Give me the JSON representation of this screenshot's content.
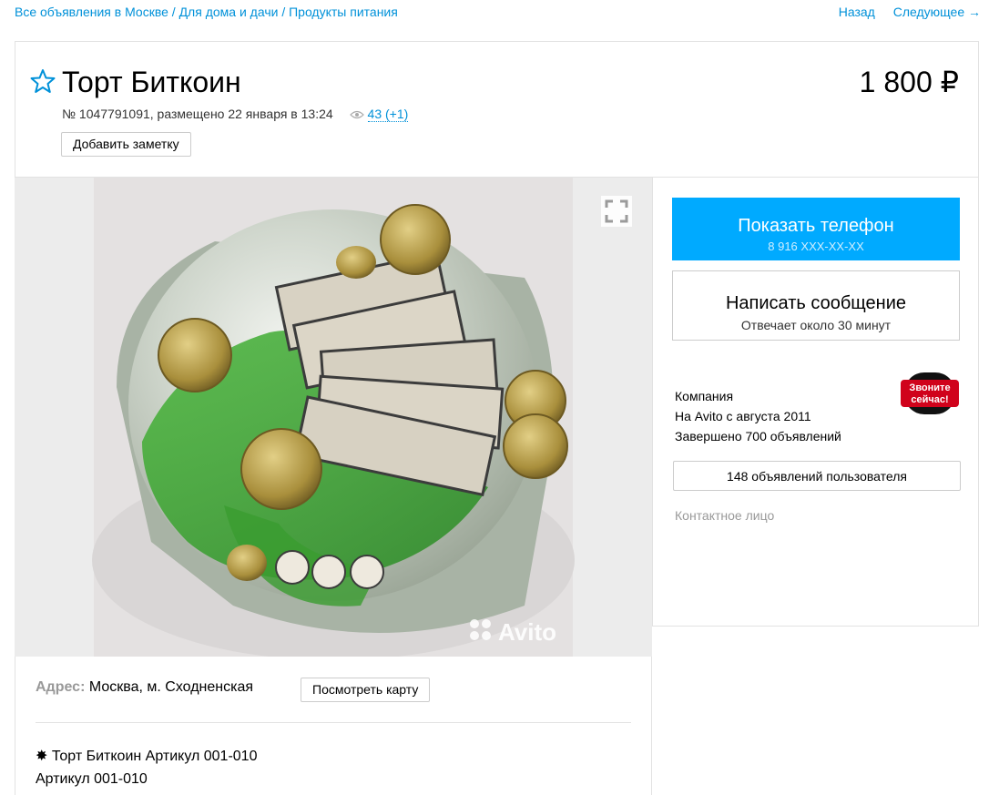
{
  "breadcrumbs": {
    "items": [
      "Все объявления в Москве",
      "Для дома и дачи",
      "Продукты питания"
    ],
    "separator": " / "
  },
  "nav": {
    "back": "Назад",
    "next": "Следующее →"
  },
  "listing": {
    "title": "Торт Биткоин",
    "price": "1 800 ₽",
    "meta": "№ 1047791091, размещено 22 января в 13:24",
    "views": "43 (+1)",
    "add_note": "Добавить заметку"
  },
  "photo": {
    "watermark": "Avito"
  },
  "contact_panel": {
    "phone_title": "Показать телефон",
    "phone_masked": "8 916 XXX-XX-XX",
    "message_title": "Написать сообщение",
    "message_sub": "Отвечает около 30 минут",
    "seller_type": "Компания",
    "seller_since": "На Avito с августа 2011",
    "seller_done": "Завершено 700 объявлений",
    "badge_line1": "Звоните",
    "badge_line2": "сейчас!",
    "user_ads": "148 объявлений пользователя",
    "contact_person": "Контактное лицо"
  },
  "address": {
    "label": "Адрес:",
    "value": "Москва, м. Сходненская",
    "map_button": "Посмотреть карту"
  },
  "description": {
    "line1": "✸ Торт Биткоин Артикул 001-010",
    "line2": "Артикул 001-010"
  },
  "colors": {
    "link": "#0091d9",
    "primary_button": "#00aaff",
    "badge_red": "#d0021b"
  }
}
